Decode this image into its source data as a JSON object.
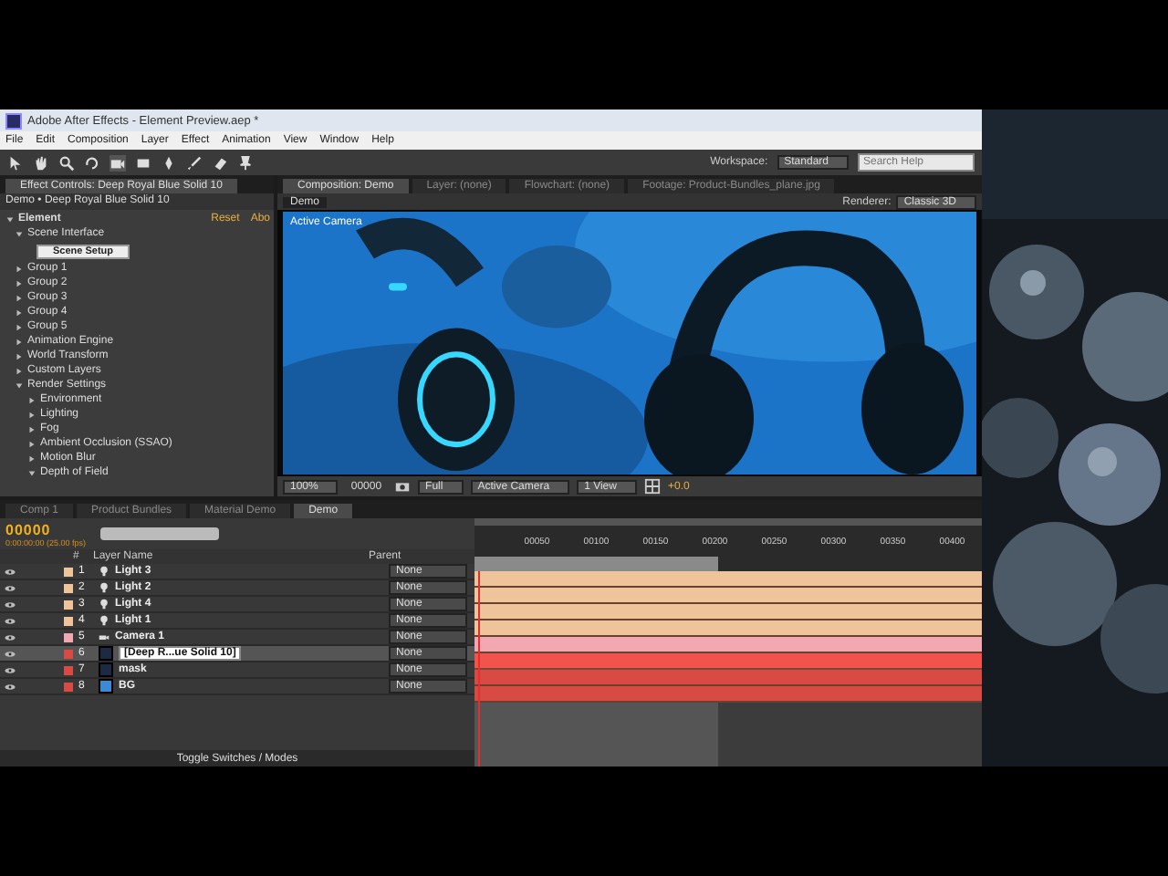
{
  "window": {
    "title": "Adobe After Effects - Element Preview.aep *"
  },
  "menu": [
    "File",
    "Edit",
    "Composition",
    "Layer",
    "Effect",
    "Animation",
    "View",
    "Window",
    "Help"
  ],
  "toolbar": {
    "workspace_label": "Workspace:",
    "workspace": "Standard",
    "search": {
      "placeholder": "Search Help"
    }
  },
  "effect_controls": {
    "tab": "Effect Controls: Deep Royal Blue Solid 10",
    "breadcrumb": "Demo • Deep Royal Blue Solid 10",
    "effect": "Element",
    "reset": "Reset",
    "about": "Abo",
    "expanded": true,
    "tree": [
      {
        "label": "Scene Interface",
        "expanded": true,
        "button": "Scene Setup"
      },
      {
        "label": "Group 1",
        "expanded": false
      },
      {
        "label": "Group 2",
        "expanded": false
      },
      {
        "label": "Group 3",
        "expanded": false
      },
      {
        "label": "Group 4",
        "expanded": false
      },
      {
        "label": "Group 5",
        "expanded": false
      },
      {
        "label": "Animation Engine",
        "expanded": false
      },
      {
        "label": "World Transform",
        "expanded": false
      },
      {
        "label": "Custom Layers",
        "expanded": false
      },
      {
        "label": "Render Settings",
        "expanded": true,
        "children": [
          {
            "label": "Environment",
            "expanded": false
          },
          {
            "label": "Lighting",
            "expanded": false
          },
          {
            "label": "Fog",
            "expanded": false
          },
          {
            "label": "Ambient Occlusion (SSAO)",
            "expanded": false
          },
          {
            "label": "Motion Blur",
            "expanded": false
          },
          {
            "label": "Depth of Field",
            "expanded": true
          }
        ]
      }
    ]
  },
  "viewer": {
    "tabs": [
      {
        "label": "Composition: Demo",
        "selected": true
      },
      {
        "label": "Layer: (none)",
        "selected": false
      },
      {
        "label": "Flowchart: (none)",
        "selected": false
      },
      {
        "label": "Footage: Product-Bundles_plane.jpg",
        "selected": false
      }
    ],
    "sub_tab": "Demo",
    "renderer_label": "Renderer:",
    "renderer": "Classic 3D",
    "overlay": "Active Camera",
    "controls": {
      "zoom": "100%",
      "time": "00000",
      "resolution": "Full",
      "camera": "Active Camera",
      "views": "1 View",
      "exposure": "+0.0"
    }
  },
  "timeline": {
    "tabs": [
      {
        "label": "Comp 1",
        "selected": false
      },
      {
        "label": "Product Bundles",
        "selected": false
      },
      {
        "label": "Material Demo",
        "selected": false
      },
      {
        "label": "Demo",
        "selected": true
      }
    ],
    "timecode": "00000",
    "fps": "0:00:00:00 (25.00 fps)",
    "columns": {
      "number": "#",
      "name": "Layer Name",
      "parent": "Parent"
    },
    "ruler": [
      "00050",
      "00100",
      "00150",
      "00200",
      "00250",
      "00300",
      "00350",
      "00400"
    ],
    "layers": [
      {
        "number": "1",
        "name": "Light 3",
        "kind": "light",
        "color": "#f0c49a",
        "parent": "None",
        "selected": false
      },
      {
        "number": "2",
        "name": "Light 2",
        "kind": "light",
        "color": "#f0c49a",
        "parent": "None",
        "selected": false
      },
      {
        "number": "3",
        "name": "Light 4",
        "kind": "light",
        "color": "#f0c49a",
        "parent": "None",
        "selected": false
      },
      {
        "number": "4",
        "name": "Light 1",
        "kind": "light",
        "color": "#f0c49a",
        "parent": "None",
        "selected": false
      },
      {
        "number": "5",
        "name": "Camera 1",
        "kind": "camera",
        "color": "#f2a8b0",
        "parent": "None",
        "selected": false
      },
      {
        "number": "6",
        "name": "[Deep R...ue Solid 10]",
        "kind": "solid",
        "color": "#d84a44",
        "parent": "None",
        "selected": true
      },
      {
        "number": "7",
        "name": "mask",
        "kind": "solid",
        "color": "#d84a44",
        "parent": "None",
        "selected": false
      },
      {
        "number": "8",
        "name": "BG",
        "kind": "solid",
        "color": "#d84a44",
        "parent": "None",
        "selected": false
      }
    ],
    "footer": "Toggle Switches / Modes"
  }
}
